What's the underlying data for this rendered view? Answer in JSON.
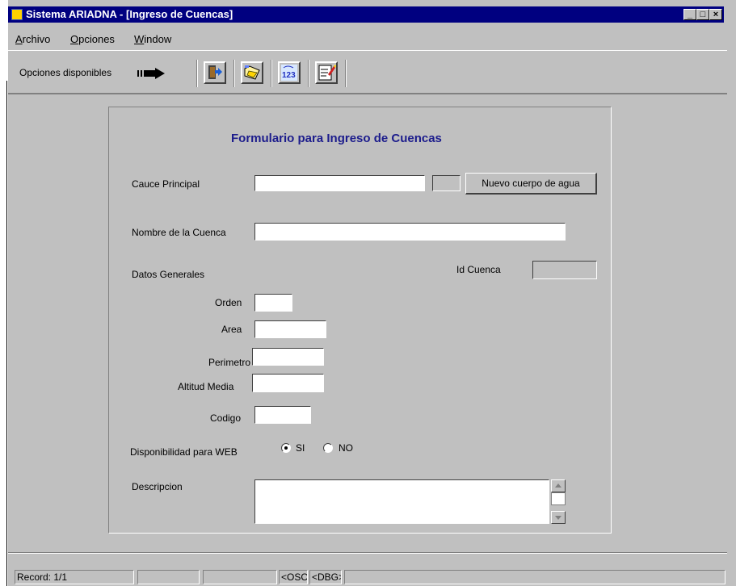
{
  "window": {
    "title": "Sistema ARIADNA - [Ingreso de Cuencas]",
    "controls": [
      "_",
      "□",
      "×"
    ]
  },
  "menu": [
    {
      "label": "Archivo",
      "mnemonic": "A",
      "rest": "rchivo"
    },
    {
      "label": "Opciones",
      "mnemonic": "O",
      "rest": "pciones"
    },
    {
      "label": "Window",
      "mnemonic": "W",
      "rest": "indow"
    }
  ],
  "toolbar": {
    "label": "Opciones disponibles",
    "buttons": [
      {
        "icon": "exit-door-icon"
      },
      {
        "icon": "save-folder-icon"
      },
      {
        "icon": "numbers-123-icon"
      },
      {
        "icon": "edit-form-icon"
      }
    ]
  },
  "form": {
    "title": "Formulario para Ingreso de Cuencas",
    "cauce_label": "Cauce Principal",
    "cauce_value": "",
    "nuevo_button": "Nuevo cuerpo de agua",
    "nombre_label": "Nombre de la Cuenca",
    "nombre_value": "",
    "datos_label": "Datos Generales",
    "id_label": "Id Cuenca",
    "id_value": "",
    "orden_label": "Orden",
    "area_label": "Area",
    "perimetro_label": "Perimetro",
    "altitud_label": "Altitud Media",
    "codigo_label": "Codigo",
    "disponibilidad_label": "Disponibilidad para WEB",
    "radio_si": "SI",
    "radio_no": "NO",
    "radio_selected": "SI",
    "descripcion_label": "Descripcion"
  },
  "status": {
    "record": "Record: 1/1",
    "osc": "<OSC>",
    "dbg": "<DBG>"
  },
  "colors": {
    "titlebar": "#000080",
    "form_title": "#1c1c8c",
    "face": "#c0c0c0"
  }
}
